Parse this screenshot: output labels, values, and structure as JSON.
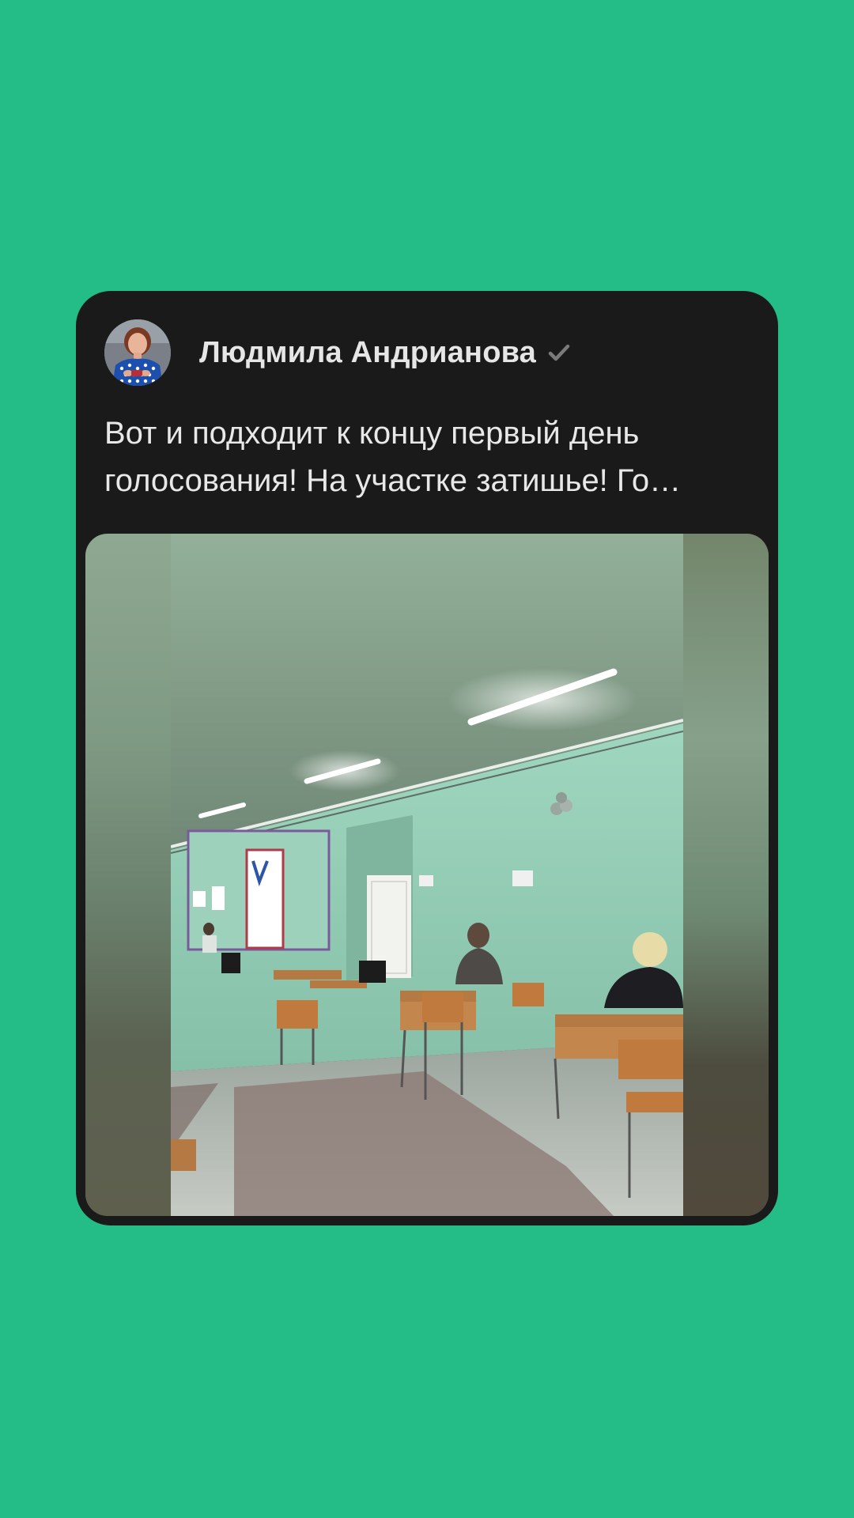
{
  "post": {
    "author_name": "Людмила Андрианова",
    "verified": true,
    "text": "Вот и подходит к концу первый день голосования! На участке затишье! Го…",
    "avatar_icon": "avatar-photo",
    "verified_icon": "checkmark-icon",
    "media_description": "photo"
  },
  "colors": {
    "background": "#24bd87",
    "card": "#1a1a1a",
    "text": "#e8e8e8"
  }
}
